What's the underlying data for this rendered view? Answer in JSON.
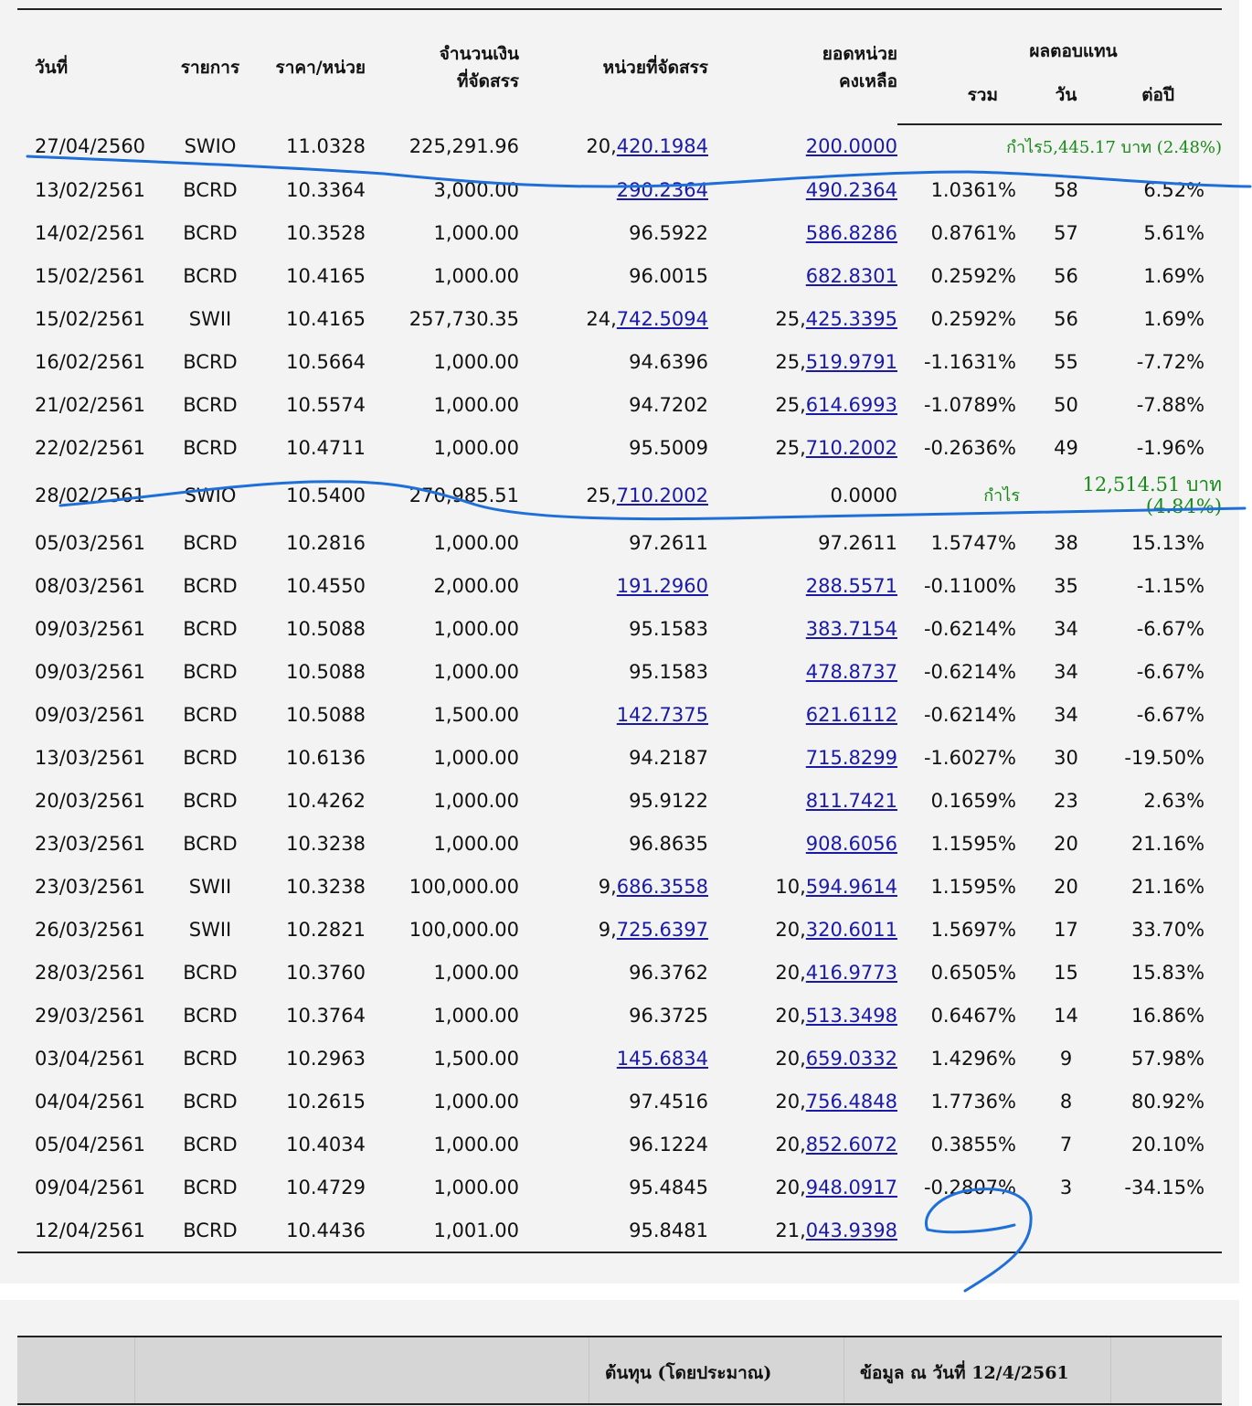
{
  "headers": {
    "date": "วันที่",
    "type": "รายการ",
    "price": "ราคา/หน่วย",
    "amount_1": "จำนวนเงิน",
    "amount_2": "ที่จัดสรร",
    "units": "หน่วยที่จัดสรร",
    "balance_1": "ยอดหน่วย",
    "balance_2": "คงเหลือ",
    "return_group": "ผลตอบแทน",
    "return_total": "รวม",
    "return_days": "วัน",
    "return_yearly": "ต่อปี"
  },
  "rows": [
    {
      "date": "27/04/2560",
      "type": "SWIO",
      "price": "11.0328",
      "amount": "225,291.96",
      "units_pre": "20,",
      "units_link": "420.1984",
      "bal_pre": "",
      "bal_link": "200.0000",
      "note": "กำไร5,445.17  บาท (2.48%)"
    },
    {
      "date": "13/02/2561",
      "type": "BCRD",
      "price": "10.3364",
      "amount": "3,000.00",
      "units_pre": "",
      "units_link": "290.2364",
      "bal_pre": "",
      "bal_link": "490.2364",
      "total": "1.0361%",
      "days": "58",
      "yearly": "6.52%"
    },
    {
      "date": "14/02/2561",
      "type": "BCRD",
      "price": "10.3528",
      "amount": "1,000.00",
      "units_pre": "96.5922",
      "units_link": "",
      "bal_pre": "",
      "bal_link": "586.8286",
      "total": "0.8761%",
      "days": "57",
      "yearly": "5.61%"
    },
    {
      "date": "15/02/2561",
      "type": "BCRD",
      "price": "10.4165",
      "amount": "1,000.00",
      "units_pre": "96.0015",
      "units_link": "",
      "bal_pre": "",
      "bal_link": "682.8301",
      "total": "0.2592%",
      "days": "56",
      "yearly": "1.69%"
    },
    {
      "date": "15/02/2561",
      "type": "SWII",
      "price": "10.4165",
      "amount": "257,730.35",
      "units_pre": "24,",
      "units_link": "742.5094",
      "bal_pre": "25,",
      "bal_link": "425.3395",
      "total": "0.2592%",
      "days": "56",
      "yearly": "1.69%"
    },
    {
      "date": "16/02/2561",
      "type": "BCRD",
      "price": "10.5664",
      "amount": "1,000.00",
      "units_pre": "94.6396",
      "units_link": "",
      "bal_pre": "25,",
      "bal_link": "519.9791",
      "total": "-1.1631%",
      "days": "55",
      "yearly": "-7.72%"
    },
    {
      "date": "21/02/2561",
      "type": "BCRD",
      "price": "10.5574",
      "amount": "1,000.00",
      "units_pre": "94.7202",
      "units_link": "",
      "bal_pre": "25,",
      "bal_link": "614.6993",
      "total": "-1.0789%",
      "days": "50",
      "yearly": "-7.88%"
    },
    {
      "date": "22/02/2561",
      "type": "BCRD",
      "price": "10.4711",
      "amount": "1,000.00",
      "units_pre": "95.5009",
      "units_link": "",
      "bal_pre": "25,",
      "bal_link": "710.2002",
      "total": "-0.2636%",
      "days": "49",
      "yearly": "-1.96%"
    },
    {
      "date": "28/02/2561",
      "type": "SWIO",
      "price": "10.5400",
      "amount": "270,985.51",
      "units_pre": "25,",
      "units_link": "710.2002",
      "bal_pre": "0.0000",
      "bal_link": "",
      "profit_label": "กำไร",
      "profit_amt": "12,514.51  บาท",
      "profit_pct": "(4.84%)"
    },
    {
      "date": "05/03/2561",
      "type": "BCRD",
      "price": "10.2816",
      "amount": "1,000.00",
      "units_pre": "97.2611",
      "units_link": "",
      "bal_pre": "97.2611",
      "bal_link": "",
      "total": "1.5747%",
      "days": "38",
      "yearly": "15.13%"
    },
    {
      "date": "08/03/2561",
      "type": "BCRD",
      "price": "10.4550",
      "amount": "2,000.00",
      "units_pre": "",
      "units_link": "191.2960",
      "bal_pre": "",
      "bal_link": "288.5571",
      "total": "-0.1100%",
      "days": "35",
      "yearly": "-1.15%"
    },
    {
      "date": "09/03/2561",
      "type": "BCRD",
      "price": "10.5088",
      "amount": "1,000.00",
      "units_pre": "95.1583",
      "units_link": "",
      "bal_pre": "",
      "bal_link": "383.7154",
      "total": "-0.6214%",
      "days": "34",
      "yearly": "-6.67%"
    },
    {
      "date": "09/03/2561",
      "type": "BCRD",
      "price": "10.5088",
      "amount": "1,000.00",
      "units_pre": "95.1583",
      "units_link": "",
      "bal_pre": "",
      "bal_link": "478.8737",
      "total": "-0.6214%",
      "days": "34",
      "yearly": "-6.67%"
    },
    {
      "date": "09/03/2561",
      "type": "BCRD",
      "price": "10.5088",
      "amount": "1,500.00",
      "units_pre": "",
      "units_link": "142.7375",
      "bal_pre": "",
      "bal_link": "621.6112",
      "total": "-0.6214%",
      "days": "34",
      "yearly": "-6.67%"
    },
    {
      "date": "13/03/2561",
      "type": "BCRD",
      "price": "10.6136",
      "amount": "1,000.00",
      "units_pre": "94.2187",
      "units_link": "",
      "bal_pre": "",
      "bal_link": "715.8299",
      "total": "-1.6027%",
      "days": "30",
      "yearly": "-19.50%"
    },
    {
      "date": "20/03/2561",
      "type": "BCRD",
      "price": "10.4262",
      "amount": "1,000.00",
      "units_pre": "95.9122",
      "units_link": "",
      "bal_pre": "",
      "bal_link": "811.7421",
      "total": "0.1659%",
      "days": "23",
      "yearly": "2.63%"
    },
    {
      "date": "23/03/2561",
      "type": "BCRD",
      "price": "10.3238",
      "amount": "1,000.00",
      "units_pre": "96.8635",
      "units_link": "",
      "bal_pre": "",
      "bal_link": "908.6056",
      "total": "1.1595%",
      "days": "20",
      "yearly": "21.16%"
    },
    {
      "date": "23/03/2561",
      "type": "SWII",
      "price": "10.3238",
      "amount": "100,000.00",
      "units_pre": "9,",
      "units_link": "686.3558",
      "bal_pre": "10,",
      "bal_link": "594.9614",
      "total": "1.1595%",
      "days": "20",
      "yearly": "21.16%"
    },
    {
      "date": "26/03/2561",
      "type": "SWII",
      "price": "10.2821",
      "amount": "100,000.00",
      "units_pre": "9,",
      "units_link": "725.6397",
      "bal_pre": "20,",
      "bal_link": "320.6011",
      "total": "1.5697%",
      "days": "17",
      "yearly": "33.70%"
    },
    {
      "date": "28/03/2561",
      "type": "BCRD",
      "price": "10.3760",
      "amount": "1,000.00",
      "units_pre": "96.3762",
      "units_link": "",
      "bal_pre": "20,",
      "bal_link": "416.9773",
      "total": "0.6505%",
      "days": "15",
      "yearly": "15.83%"
    },
    {
      "date": "29/03/2561",
      "type": "BCRD",
      "price": "10.3764",
      "amount": "1,000.00",
      "units_pre": "96.3725",
      "units_link": "",
      "bal_pre": "20,",
      "bal_link": "513.3498",
      "total": "0.6467%",
      "days": "14",
      "yearly": "16.86%"
    },
    {
      "date": "03/04/2561",
      "type": "BCRD",
      "price": "10.2963",
      "amount": "1,500.00",
      "units_pre": "",
      "units_link": "145.6834",
      "bal_pre": "20,",
      "bal_link": "659.0332",
      "total": "1.4296%",
      "days": "9",
      "yearly": "57.98%"
    },
    {
      "date": "04/04/2561",
      "type": "BCRD",
      "price": "10.2615",
      "amount": "1,000.00",
      "units_pre": "97.4516",
      "units_link": "",
      "bal_pre": "20,",
      "bal_link": "756.4848",
      "total": "1.7736%",
      "days": "8",
      "yearly": "80.92%"
    },
    {
      "date": "05/04/2561",
      "type": "BCRD",
      "price": "10.4034",
      "amount": "1,000.00",
      "units_pre": "96.1224",
      "units_link": "",
      "bal_pre": "20,",
      "bal_link": "852.6072",
      "total": "0.3855%",
      "days": "7",
      "yearly": "20.10%"
    },
    {
      "date": "09/04/2561",
      "type": "BCRD",
      "price": "10.4729",
      "amount": "1,000.00",
      "units_pre": "95.4845",
      "units_link": "",
      "bal_pre": "20,",
      "bal_link": "948.0917",
      "total": "-0.2807%",
      "days": "3",
      "yearly": "-34.15%"
    },
    {
      "date": "12/04/2561",
      "type": "BCRD",
      "price": "10.4436",
      "amount": "1,001.00",
      "units_pre": "95.8481",
      "units_link": "",
      "bal_pre": "21,",
      "bal_link": "043.9398",
      "total": "",
      "days": "",
      "yearly": ""
    }
  ],
  "footer": {
    "cost_label": "ต้นทุน (โดยประมาณ)",
    "as_of_label": "ข้อมูล ณ วันที่ 12/4/2561"
  },
  "colors": {
    "link": "#1a1aa6",
    "profit": "#178a17",
    "ink": "#1f6fd8",
    "panel": "#f3f3f3",
    "footer_bar": "#d6d6d6"
  }
}
